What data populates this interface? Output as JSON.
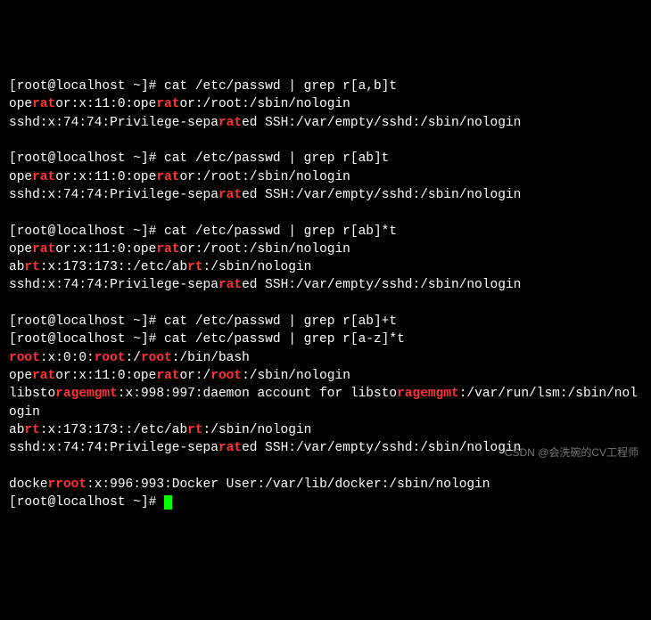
{
  "prompt": "[root@localhost ~]# ",
  "watermark": "CSDN @会洗碗的CV工程师",
  "lines": [
    {
      "prompt": true,
      "segs": [
        [
          "w",
          "cat /etc/passwd | grep r[a,b]t"
        ]
      ]
    },
    {
      "segs": [
        [
          "w",
          "ope"
        ],
        [
          "h",
          "rat"
        ],
        [
          "w",
          "or:x:11:0:ope"
        ],
        [
          "h",
          "rat"
        ],
        [
          "w",
          "or:/root:/sbin/nologin"
        ]
      ]
    },
    {
      "segs": [
        [
          "w",
          "sshd:x:74:74:Privilege-sepa"
        ],
        [
          "h",
          "rat"
        ],
        [
          "w",
          "ed SSH:/var/empty/sshd:/sbin/nologin"
        ]
      ]
    },
    {
      "segs": []
    },
    {
      "prompt": true,
      "segs": [
        [
          "w",
          "cat /etc/passwd | grep r[ab]t"
        ]
      ]
    },
    {
      "segs": [
        [
          "w",
          "ope"
        ],
        [
          "h",
          "rat"
        ],
        [
          "w",
          "or:x:11:0:ope"
        ],
        [
          "h",
          "rat"
        ],
        [
          "w",
          "or:/root:/sbin/nologin"
        ]
      ]
    },
    {
      "segs": [
        [
          "w",
          "sshd:x:74:74:Privilege-sepa"
        ],
        [
          "h",
          "rat"
        ],
        [
          "w",
          "ed SSH:/var/empty/sshd:/sbin/nologin"
        ]
      ]
    },
    {
      "segs": []
    },
    {
      "prompt": true,
      "segs": [
        [
          "w",
          "cat /etc/passwd | grep r[ab]*t"
        ]
      ]
    },
    {
      "segs": [
        [
          "w",
          "ope"
        ],
        [
          "h",
          "rat"
        ],
        [
          "w",
          "or:x:11:0:ope"
        ],
        [
          "h",
          "rat"
        ],
        [
          "w",
          "or:/root:/sbin/nologin"
        ]
      ]
    },
    {
      "segs": [
        [
          "w",
          "ab"
        ],
        [
          "h",
          "rt"
        ],
        [
          "w",
          ":x:173:173::/etc/ab"
        ],
        [
          "h",
          "rt"
        ],
        [
          "w",
          ":/sbin/nologin"
        ]
      ]
    },
    {
      "segs": [
        [
          "w",
          "sshd:x:74:74:Privilege-sepa"
        ],
        [
          "h",
          "rat"
        ],
        [
          "w",
          "ed SSH:/var/empty/sshd:/sbin/nologin"
        ]
      ]
    },
    {
      "segs": []
    },
    {
      "prompt": true,
      "segs": [
        [
          "w",
          "cat /etc/passwd | grep r[ab]+t"
        ]
      ]
    },
    {
      "prompt": true,
      "segs": [
        [
          "w",
          "cat /etc/passwd | grep r[a-z]*t"
        ]
      ]
    },
    {
      "segs": [
        [
          "h",
          "root"
        ],
        [
          "w",
          ":x:0:0:"
        ],
        [
          "h",
          "root"
        ],
        [
          "w",
          ":/"
        ],
        [
          "h",
          "root"
        ],
        [
          "w",
          ":/bin/bash"
        ]
      ]
    },
    {
      "segs": [
        [
          "w",
          "ope"
        ],
        [
          "h",
          "rat"
        ],
        [
          "w",
          "or:x:11:0:ope"
        ],
        [
          "h",
          "rat"
        ],
        [
          "w",
          "or:/"
        ],
        [
          "h",
          "root"
        ],
        [
          "w",
          ":/sbin/nologin"
        ]
      ]
    },
    {
      "segs": [
        [
          "w",
          "libsto"
        ],
        [
          "h",
          "ragemgmt"
        ],
        [
          "w",
          ":x:998:997:daemon account for libsto"
        ],
        [
          "h",
          "ragemgmt"
        ],
        [
          "w",
          ":/var/run/lsm:/sbin/nologin"
        ]
      ]
    },
    {
      "segs": [
        [
          "w",
          "ab"
        ],
        [
          "h",
          "rt"
        ],
        [
          "w",
          ":x:173:173::/etc/ab"
        ],
        [
          "h",
          "rt"
        ],
        [
          "w",
          ":/sbin/nologin"
        ]
      ]
    },
    {
      "segs": [
        [
          "w",
          "sshd:x:74:74:Privilege-sepa"
        ],
        [
          "h",
          "rat"
        ],
        [
          "w",
          "ed SSH:/var/empty/sshd:/sbin/nologin"
        ]
      ]
    },
    {
      "segs": []
    },
    {
      "segs": [
        [
          "w",
          "docke"
        ],
        [
          "h",
          "rroot"
        ],
        [
          "w",
          ":x:996:993:Docker User:/var/lib/docker:/sbin/nologin"
        ]
      ]
    },
    {
      "prompt": true,
      "cursor": true,
      "segs": []
    }
  ]
}
